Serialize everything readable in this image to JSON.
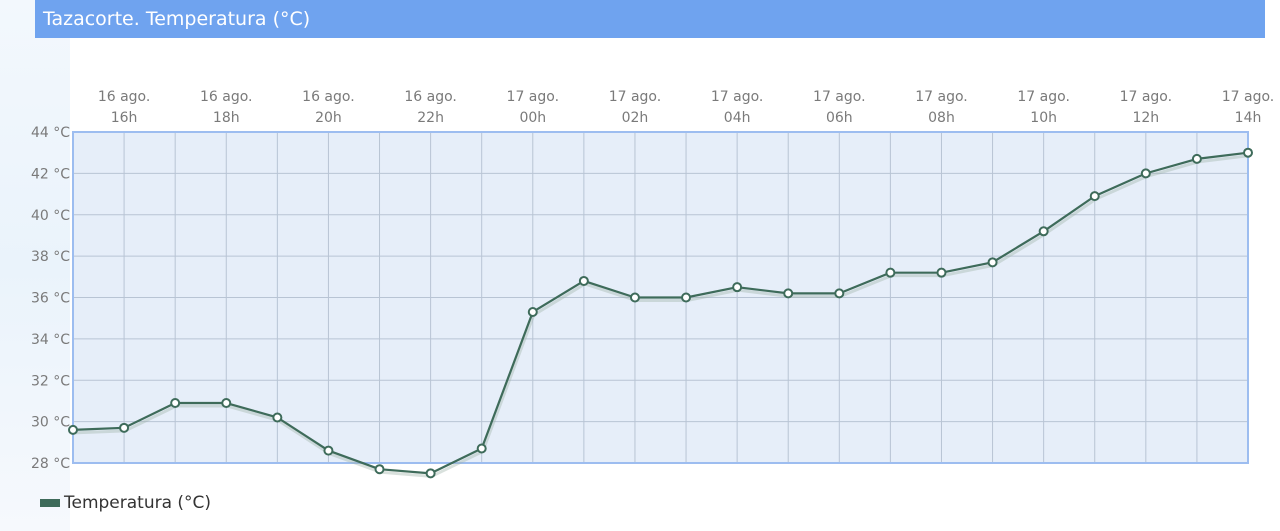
{
  "header": {
    "title": "Tazacorte. Temperatura (°C)"
  },
  "colors": {
    "title_bg": "#6fa3ef",
    "plot_bg": "#e6eef9",
    "plot_border": "#9dbdf0",
    "grid": "#b8c4d4",
    "series": "#3e6b5a",
    "axis_text": "#7a7a7a"
  },
  "legend": {
    "label": "Temperatura (°C)"
  },
  "chart_data": {
    "type": "line",
    "title": "Tazacorte. Temperatura (°C)",
    "xlabel": "",
    "ylabel": "",
    "ylim": [
      28,
      44
    ],
    "y_ticks": [
      "44 °C",
      "42 °C",
      "40 °C",
      "38 °C",
      "36 °C",
      "34 °C",
      "32 °C",
      "30 °C",
      "28 °C"
    ],
    "x_ticks": [
      {
        "date": "16 ago.",
        "hour": "16h"
      },
      {
        "date": "16 ago.",
        "hour": "18h"
      },
      {
        "date": "16 ago.",
        "hour": "20h"
      },
      {
        "date": "16 ago.",
        "hour": "22h"
      },
      {
        "date": "17 ago.",
        "hour": "00h"
      },
      {
        "date": "17 ago.",
        "hour": "02h"
      },
      {
        "date": "17 ago.",
        "hour": "04h"
      },
      {
        "date": "17 ago.",
        "hour": "06h"
      },
      {
        "date": "17 ago.",
        "hour": "08h"
      },
      {
        "date": "17 ago.",
        "hour": "10h"
      },
      {
        "date": "17 ago.",
        "hour": "12h"
      },
      {
        "date": "17 ago.",
        "hour": "14h"
      }
    ],
    "x_times": [
      "16 ago. 15h",
      "16 ago. 16h",
      "16 ago. 17h",
      "16 ago. 18h",
      "16 ago. 19h",
      "16 ago. 20h",
      "16 ago. 21h",
      "16 ago. 22h",
      "16 ago. 23h",
      "17 ago. 00h",
      "17 ago. 01h",
      "17 ago. 02h",
      "17 ago. 03h",
      "17 ago. 04h",
      "17 ago. 05h",
      "17 ago. 06h",
      "17 ago. 07h",
      "17 ago. 08h",
      "17 ago. 09h",
      "17 ago. 10h",
      "17 ago. 11h",
      "17 ago. 12h",
      "17 ago. 13h",
      "17 ago. 14h"
    ],
    "grid": true,
    "legend_position": "bottom-left",
    "series": [
      {
        "name": "Temperatura (°C)",
        "values": [
          29.6,
          29.7,
          30.9,
          30.9,
          30.2,
          28.6,
          27.7,
          27.5,
          28.7,
          35.3,
          36.8,
          36.0,
          36.0,
          36.5,
          36.2,
          36.2,
          37.2,
          37.2,
          37.7,
          39.2,
          40.9,
          42.0,
          42.7,
          43.0
        ]
      }
    ]
  }
}
